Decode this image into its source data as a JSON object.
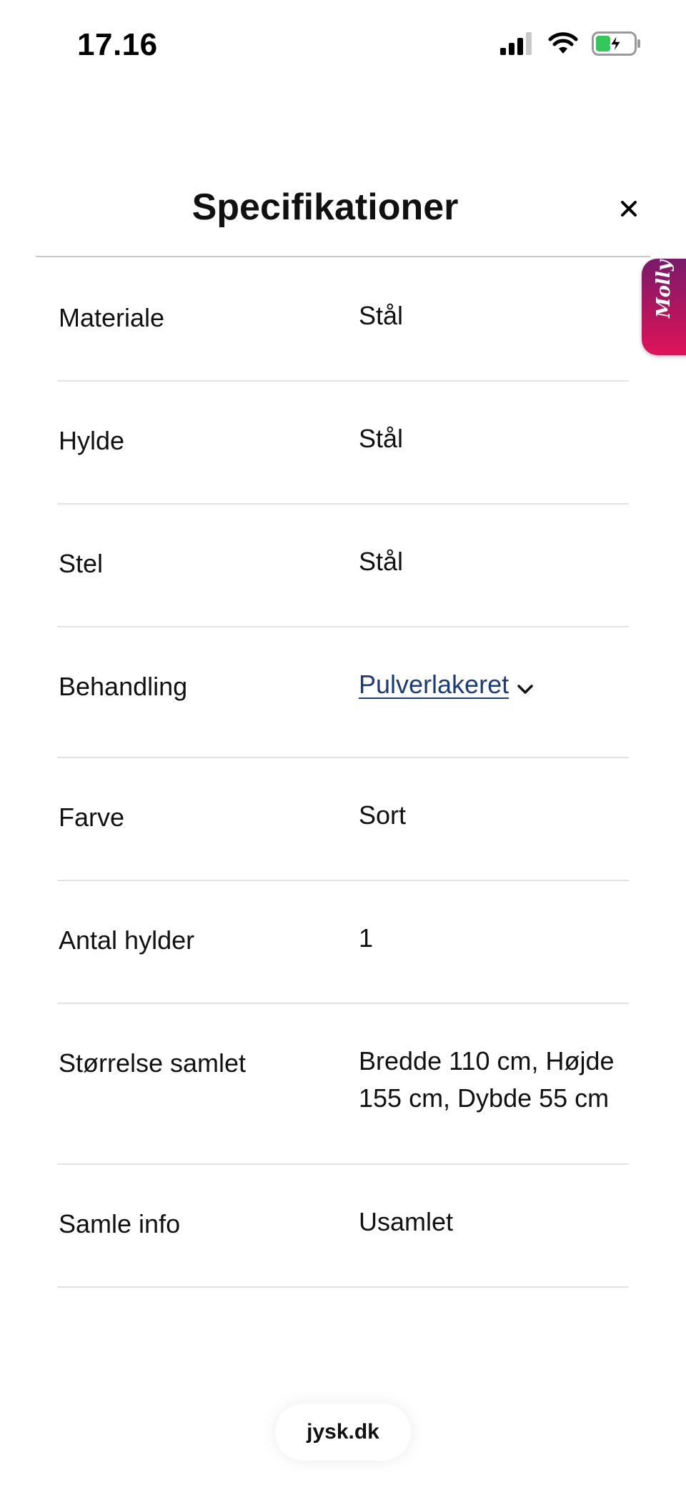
{
  "status_bar": {
    "time": "17.16",
    "icons": [
      "cellular-signal-icon",
      "wifi-icon",
      "battery-charging-icon"
    ]
  },
  "sheet": {
    "title": "Specifikationer",
    "close_icon": "close-icon"
  },
  "molly_tab": {
    "label": "Molly"
  },
  "specs": [
    {
      "label": "Materiale",
      "value": "Stål"
    },
    {
      "label": "Hylde",
      "value": "Stål"
    },
    {
      "label": "Stel",
      "value": "Stål"
    },
    {
      "label": "Behandling",
      "value": "Pulverlakeret",
      "is_link": true
    },
    {
      "label": "Farve",
      "value": "Sort"
    },
    {
      "label": "Antal hylder",
      "value": "1"
    },
    {
      "label": "Størrelse samlet",
      "value": "Bredde 110 cm, Højde 155 cm, Dybde 55 cm"
    },
    {
      "label": "Samle info",
      "value": "Usamlet"
    }
  ],
  "browser": {
    "url": "jysk.dk"
  },
  "colors": {
    "link": "#1b3c78",
    "divider": "#e2e2e2",
    "molly_gradient_start": "#7a1a6b",
    "molly_gradient_end": "#e0145b",
    "battery_green": "#34c759"
  }
}
